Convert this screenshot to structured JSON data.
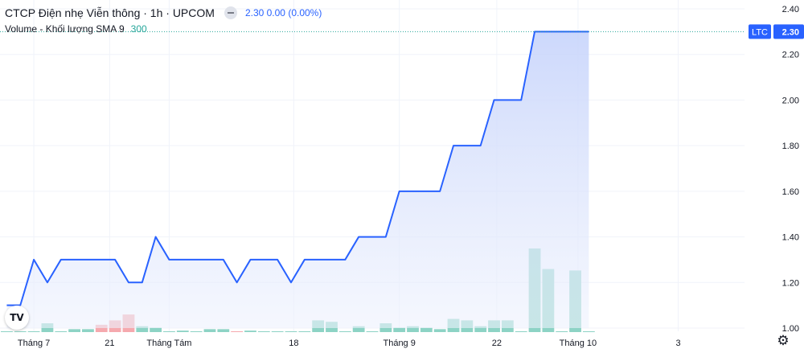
{
  "legend": {
    "symbol_title": "CTCP Điện nhẹ Viễn thông · 1h · UPCOM",
    "price_info": "2.30  0.00 (0.00%)",
    "volume_title": "Volume - Khối lượng SMA 9",
    "volume_value": "300"
  },
  "logo_text": "TV",
  "settings_icon": "gear-icon",
  "chart_data": {
    "type": "area",
    "ticker_label": "LTC",
    "last_price_label": "2.30",
    "y_ticks": [
      "2.40",
      "2.20",
      "2.00",
      "1.80",
      "1.60",
      "1.40",
      "1.20",
      "1.00"
    ],
    "ylim": [
      1.0,
      2.4
    ],
    "x_ticks": [
      "Tháng 7",
      "21",
      "Tháng Tám",
      "18",
      "Tháng 9",
      "22",
      "Tháng 10",
      "3"
    ],
    "x": [
      0,
      1,
      2,
      3,
      4,
      5,
      6,
      7,
      8,
      9,
      10,
      11,
      12,
      13,
      14,
      15,
      16,
      17,
      18,
      19,
      20,
      21,
      22,
      23,
      24,
      25,
      26,
      27,
      28,
      29,
      30,
      31,
      32,
      33,
      34,
      35,
      36,
      37,
      38,
      39,
      40,
      41,
      42,
      43
    ],
    "x_tick_positions": [
      2.0,
      7.6,
      12.0,
      21.2,
      29.0,
      36.2,
      42.2,
      49.6
    ],
    "xlim": [
      -0.5,
      54.5
    ],
    "series": [
      {
        "values": [
          1.1,
          1.1,
          1.3,
          1.2,
          1.3,
          1.3,
          1.3,
          1.3,
          1.3,
          1.2,
          1.2,
          1.4,
          1.3,
          1.3,
          1.3,
          1.3,
          1.3,
          1.2,
          1.3,
          1.3,
          1.3,
          1.2,
          1.3,
          1.3,
          1.3,
          1.3,
          1.4,
          1.4,
          1.4,
          1.6,
          1.6,
          1.6,
          1.6,
          1.8,
          1.8,
          1.8,
          2.0,
          2.0,
          2.0,
          2.3,
          2.3,
          2.3,
          2.3,
          2.3
        ],
        "volumes": [
          0,
          0,
          0,
          6,
          0,
          2,
          2,
          5,
          8,
          12,
          4,
          3,
          0,
          1,
          0,
          2,
          2,
          0,
          1,
          0,
          0,
          0,
          0,
          8,
          7,
          0,
          4,
          0,
          6,
          3,
          4,
          3,
          2,
          9,
          8,
          4,
          8,
          8,
          0,
          57,
          43,
          0,
          42,
          0
        ],
        "volume_colors": [
          "g",
          "g",
          "g",
          "g",
          "g",
          "g",
          "g",
          "r",
          "r",
          "r",
          "g",
          "g",
          "g",
          "g",
          "g",
          "g",
          "g",
          "r",
          "g",
          "g",
          "g",
          "g",
          "g",
          "g",
          "g",
          "g",
          "g",
          "g",
          "g",
          "g",
          "g",
          "g",
          "g",
          "g",
          "g",
          "g",
          "g",
          "g",
          "g",
          "g",
          "g",
          "g",
          "g",
          "g"
        ]
      }
    ],
    "colors": {
      "line": "#2962ff",
      "area_top": "#c7d4fb",
      "area_bottom": "#eef2fd",
      "volume_up": "#8dd3c5",
      "volume_down": "#f5a9ae",
      "grid": "#f0f3fa",
      "price_line": "#26a69a"
    },
    "grid": true
  }
}
